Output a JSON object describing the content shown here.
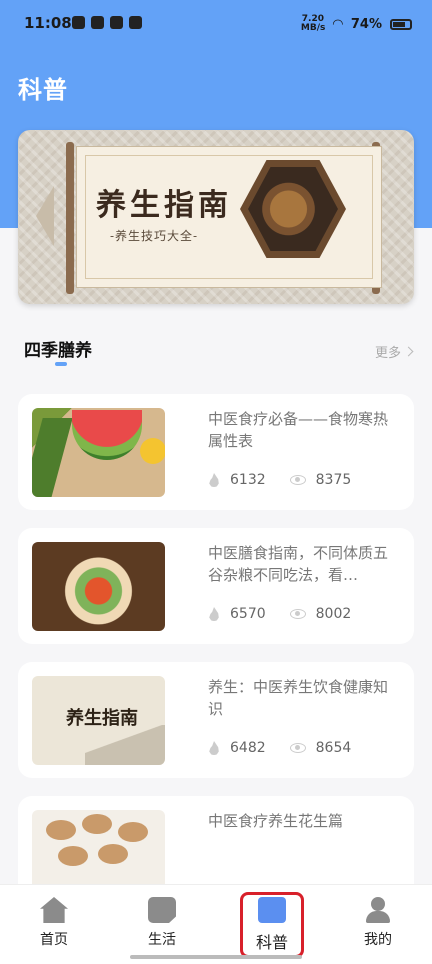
{
  "status_bar": {
    "time": "11:08",
    "speed": "7.20 MB/s",
    "battery": "74%"
  },
  "header": {
    "title": "科普"
  },
  "banner": {
    "title": "养生指南",
    "subtitle": "-养生技巧大全-"
  },
  "section": {
    "title": "四季膳养",
    "more_label": "更多"
  },
  "articles": [
    {
      "title": "中医食疗必备——食物寒热属性表",
      "likes": "6132",
      "views": "8375"
    },
    {
      "title": "中医膳食指南，不同体质五谷杂粮不同吃法，看…",
      "likes": "6570",
      "views": "8002"
    },
    {
      "title": "养生：中医养生饮食健康知识",
      "likes": "6482",
      "views": "8654",
      "thumb_text": "养生指南"
    },
    {
      "title": "中医食疗养生花生篇"
    }
  ],
  "nav": {
    "items": [
      {
        "label": "首页",
        "icon": "home-icon"
      },
      {
        "label": "生活",
        "icon": "note-icon"
      },
      {
        "label": "科普",
        "icon": "article-icon"
      },
      {
        "label": "我的",
        "icon": "user-icon"
      }
    ],
    "active": "科普"
  },
  "colors": {
    "header": "#63a2f7",
    "accent": "#5b8ff0",
    "highlight_border": "#d8202a"
  }
}
